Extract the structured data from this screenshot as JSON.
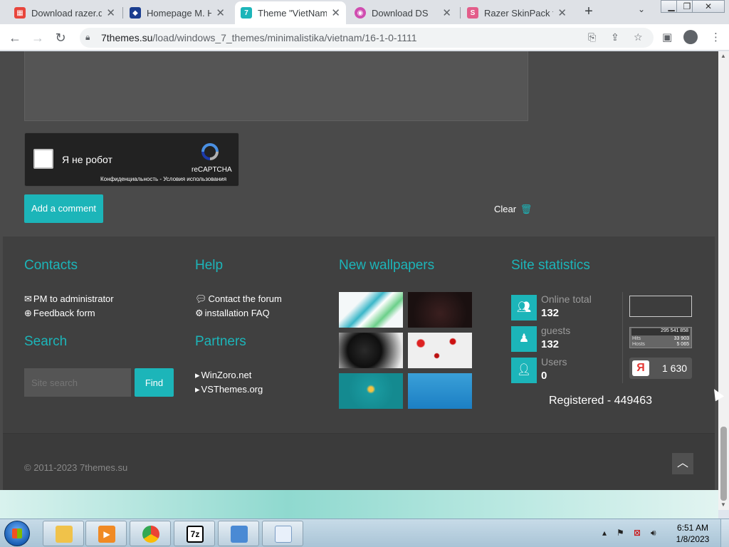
{
  "browser": {
    "tabs": [
      {
        "label": "Download razer.d",
        "fav_color": "#e8453c",
        "fav_glyph": "▦"
      },
      {
        "label": "Homepage M. Ho",
        "fav_color": "#1a3d8f",
        "fav_glyph": "◆"
      },
      {
        "label": "Theme \"VietNam",
        "fav_color": "#1cb5b9",
        "fav_glyph": "7"
      },
      {
        "label": "Download DS",
        "fav_color": "#d04db0",
        "fav_glyph": "◉"
      },
      {
        "label": "Razer SkinPack fo",
        "fav_color": "#e35d8a",
        "fav_glyph": "S"
      }
    ],
    "url_host": "7themes.su",
    "url_path": "/load/windows_7_themes/minimalistika/vietnam/16-1-0-1111"
  },
  "comment_form": {
    "captcha_label": "Я не робот",
    "captcha_brand": "reCAPTCHA",
    "captcha_terms": "Конфиденциальность - Условия использования",
    "add_comment": "Add a comment",
    "clear": "Clear"
  },
  "footer": {
    "contacts": {
      "title": "Contacts",
      "links": [
        "PM to administrator",
        "Feedback form"
      ]
    },
    "help": {
      "title": "Help",
      "links": [
        "Contact the forum",
        "installation FAQ"
      ]
    },
    "search": {
      "title": "Search",
      "placeholder": "Site search",
      "button": "Find"
    },
    "partners": {
      "title": "Partners",
      "links": [
        "WinZoro.net",
        "VSThemes.org"
      ]
    },
    "wallpapers": {
      "title": "New wallpapers"
    },
    "stats": {
      "title": "Site statistics",
      "online_label": "Online total",
      "online_value": "132",
      "guests_label": "guests",
      "guests_value": "132",
      "users_label": "Users",
      "users_value": "0",
      "registered": "Registered - 449463",
      "ucoz_total": "295 541 858",
      "hits_label": "Hits",
      "hits_value": "33 903",
      "hosts_label": "Hosts",
      "hosts_value": "5 065",
      "yandex_count": "1 630"
    }
  },
  "bottom": {
    "copyright": "© 2011-2023 7themes.su"
  },
  "taskbar": {
    "time": "6:51 AM",
    "date": "1/8/2023",
    "app_7z": "7z"
  }
}
